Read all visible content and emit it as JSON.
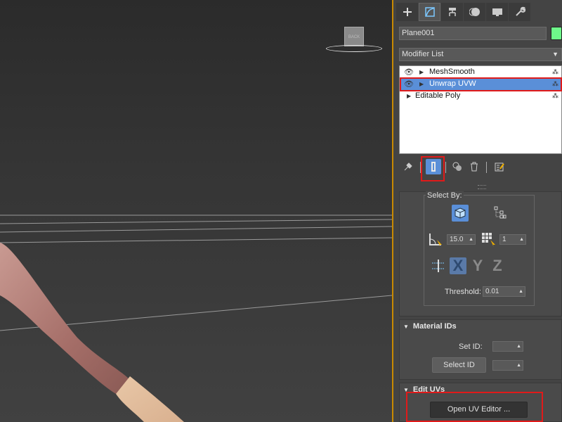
{
  "viewport": {
    "viewcube_label": "BACK"
  },
  "panel": {
    "tabs": [
      {
        "icon": "plus-icon"
      },
      {
        "icon": "modify-icon"
      },
      {
        "icon": "hierarchy-icon"
      },
      {
        "icon": "motion-icon"
      },
      {
        "icon": "display-icon"
      },
      {
        "icon": "utilities-icon"
      }
    ],
    "object_name": "Plane001",
    "object_color": "#6ef78a",
    "modifier_list_label": "Modifier List",
    "stack": [
      {
        "label": "MeshSmooth",
        "selected": false
      },
      {
        "label": "Unwrap UVW",
        "selected": true
      },
      {
        "label": "Editable Poly",
        "selected": false
      }
    ],
    "select_by": {
      "title": "Select By:",
      "angle_value": "15.0",
      "grid_value": "1",
      "axes": [
        "X",
        "Y",
        "Z"
      ],
      "threshold_label": "Threshold:",
      "threshold_value": "0.01"
    },
    "material_ids": {
      "title": "Material IDs",
      "set_id_label": "Set ID:",
      "select_id_label": "Select ID"
    },
    "edit_uvs": {
      "title": "Edit UVs",
      "open_editor_label": "Open UV Editor ..."
    }
  },
  "colors": {
    "accent": "#5a8fd8",
    "highlight_box": "#e01a1a",
    "divider": "#c98a00"
  }
}
